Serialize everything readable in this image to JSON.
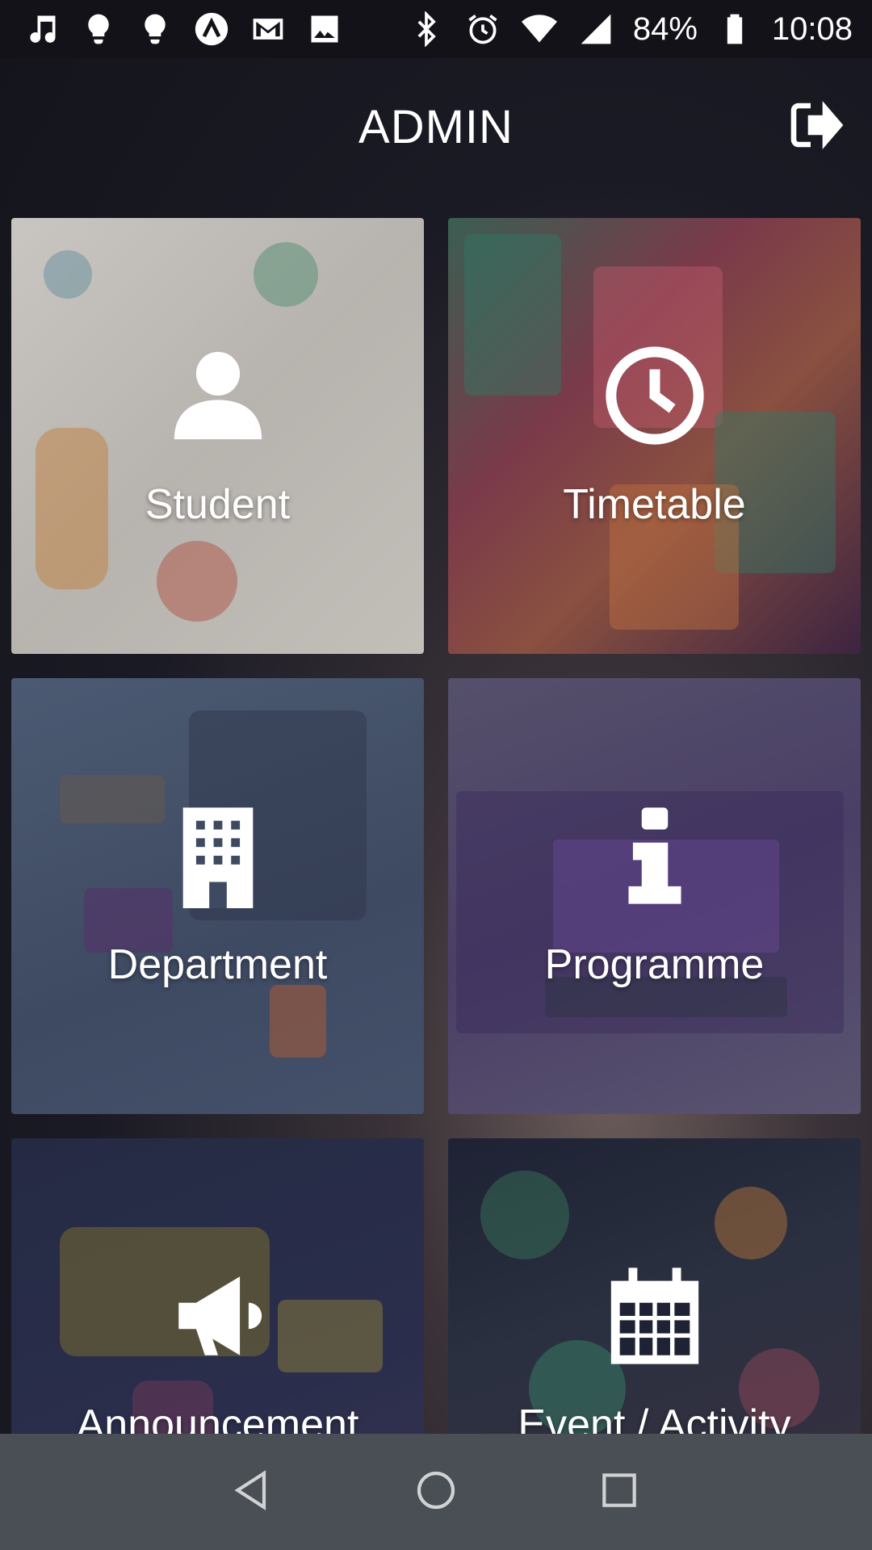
{
  "status_bar": {
    "battery": "84%",
    "time": "10:08",
    "left_icons": [
      "music-note-icon",
      "lightbulb-icon",
      "lightbulb-icon",
      "app-logo-icon",
      "gmail-icon",
      "image-icon"
    ],
    "right_icons": [
      "bluetooth-icon",
      "alarm-icon",
      "wifi-icon",
      "signal-icon",
      "battery-icon"
    ]
  },
  "header": {
    "title": "ADMIN",
    "logout_icon": "logout-icon"
  },
  "tiles": [
    {
      "label": "Student",
      "icon": "user-icon"
    },
    {
      "label": "Timetable",
      "icon": "clock-icon"
    },
    {
      "label": "Department",
      "icon": "building-icon"
    },
    {
      "label": "Programme",
      "icon": "info-icon"
    },
    {
      "label": "Announcement",
      "icon": "megaphone-icon"
    },
    {
      "label": "Event / Activity",
      "icon": "calendar-icon"
    }
  ],
  "nav_bar": {
    "buttons": [
      "back-icon",
      "home-icon",
      "recents-icon"
    ]
  },
  "colors": {
    "status_bar_bg": "#121218",
    "nav_bar_bg": "#4a4f55",
    "text": "#ffffff"
  }
}
